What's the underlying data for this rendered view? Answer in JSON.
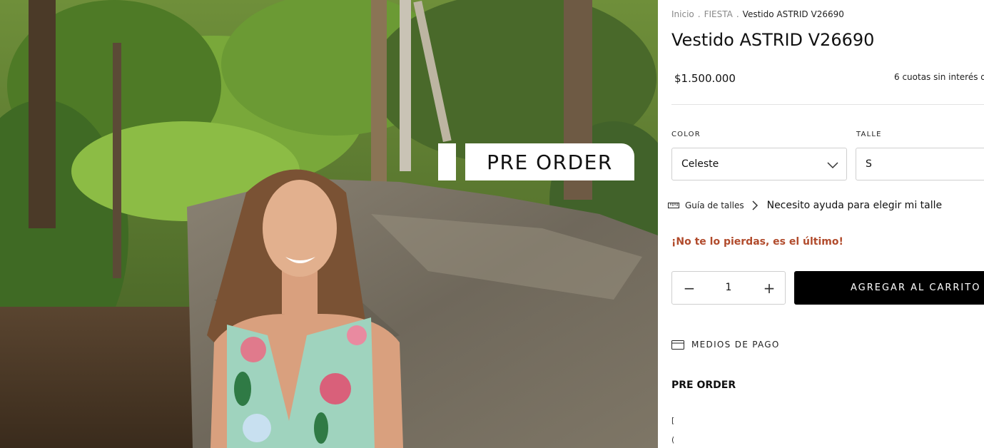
{
  "breadcrumb": {
    "items": [
      "Inicio",
      "FIESTA",
      "Vestido ASTRID V26690"
    ],
    "separator": "."
  },
  "product": {
    "title": "Vestido ASTRID V26690",
    "price": "$1.500.000",
    "installments": "6 cuotas sin interés de"
  },
  "image": {
    "badge": "PRE ORDER"
  },
  "options": {
    "color": {
      "label": "COLOR",
      "value": "Celeste"
    },
    "size": {
      "label": "TALLE",
      "value": "S"
    }
  },
  "size_guide": {
    "label": "Guía de talles",
    "help": "Necesito ayuda para elegir mi talle"
  },
  "stock_alert": "¡No te lo pierdas, es el último!",
  "quantity": {
    "value": "1",
    "minus": "−",
    "plus": "+"
  },
  "add_to_cart": "AGREGAR AL CARRITO",
  "payments": "MEDIOS DE PAGO",
  "description": {
    "heading": "PRE ORDER",
    "fragments": [
      "[",
      "("
    ]
  },
  "colors": {
    "alert": "#b14b2c",
    "button": "#000000",
    "border": "#cfcfcf"
  },
  "icons": [
    "chevron-down-icon",
    "ruler-icon",
    "chevron-right-icon",
    "minus-icon",
    "plus-icon",
    "credit-card-icon"
  ]
}
